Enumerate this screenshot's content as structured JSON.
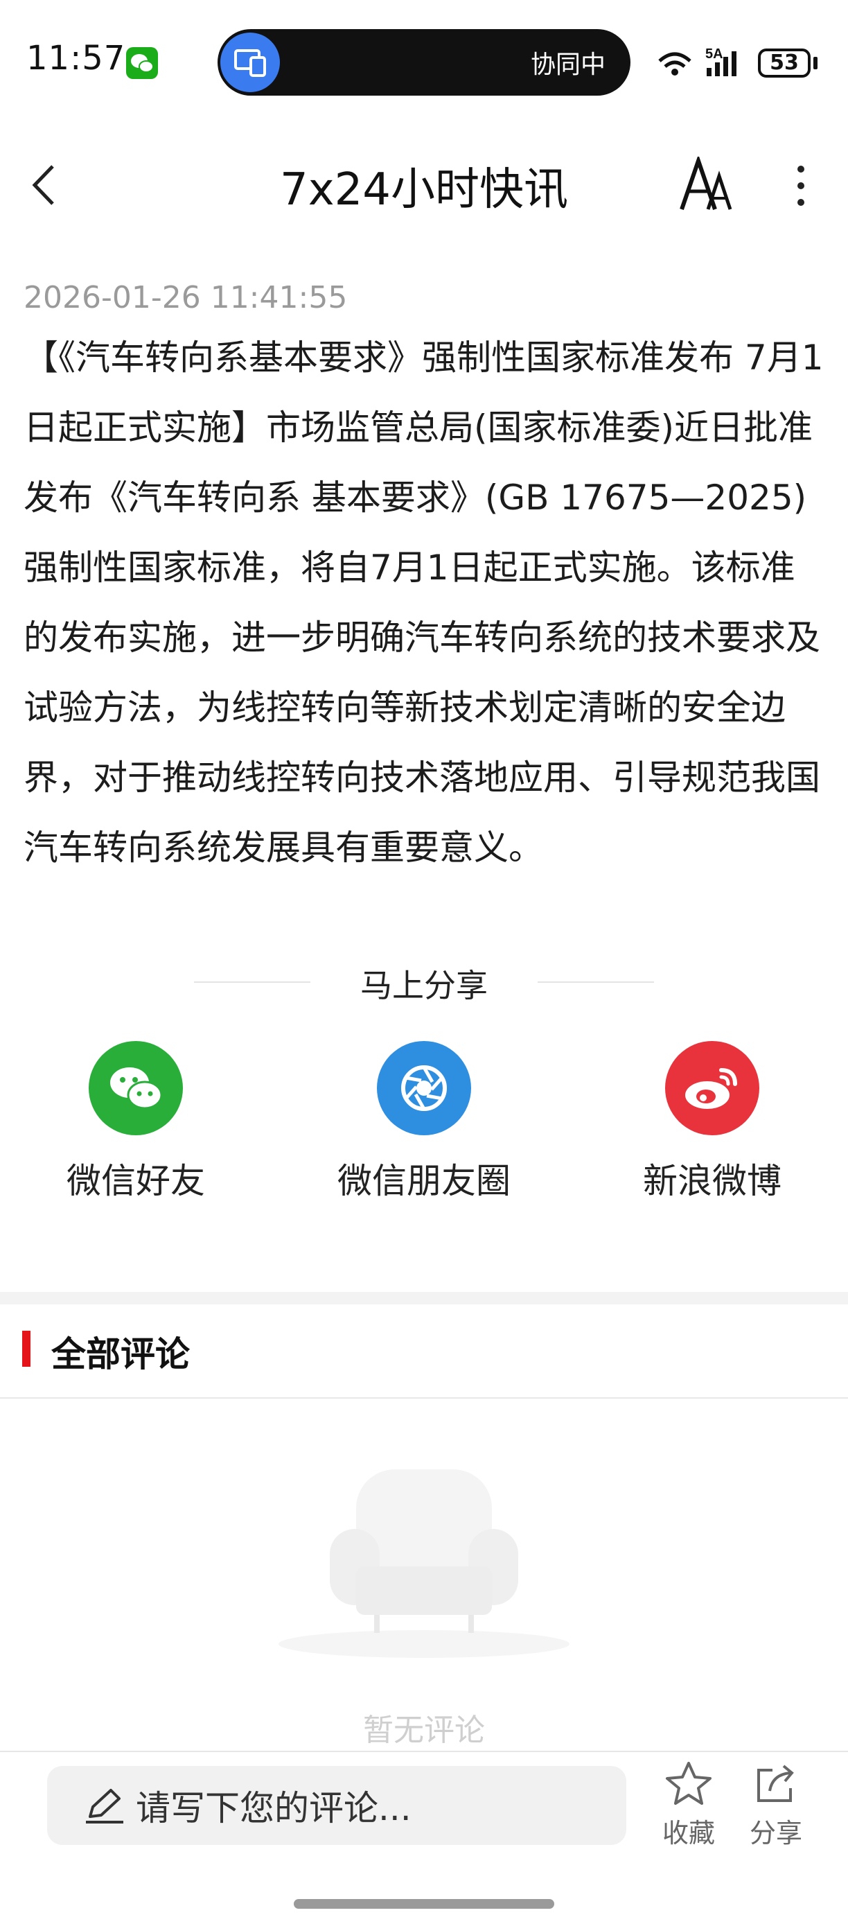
{
  "status_bar": {
    "time": "11:57",
    "island_text": "协同中",
    "network": "5A",
    "battery": "53"
  },
  "header": {
    "title": "7x24小时快讯",
    "back_icon": "chevron-left-icon",
    "font_icon": "font-size-icon",
    "more_icon": "more-vertical-icon"
  },
  "article": {
    "timestamp": "2026-01-26 11:41:55",
    "body": "【《汽车转向系基本要求》强制性国家标准发布 7月1日起正式实施】市场监管总局(国家标准委)近日批准发布《汽车转向系 基本要求》(GB 17675—2025)强制性国家标准，将自7月1日起正式实施。该标准的发布实施，进一步明确汽车转向系统的技术要求及试验方法，为线控转向等新技术划定清晰的安全边界，对于推动线控转向技术落地应用、引导规范我国汽车转向系统发展具有重要意义。"
  },
  "share": {
    "title": "马上分享",
    "items": [
      {
        "label": "微信好友",
        "icon": "wechat-icon",
        "color": "#2aae3a"
      },
      {
        "label": "微信朋友圈",
        "icon": "moments-icon",
        "color": "#2e8fe0"
      },
      {
        "label": "新浪微博",
        "icon": "weibo-icon",
        "color": "#e8333d"
      }
    ]
  },
  "comments": {
    "title": "全部评论",
    "empty_text": "暂无评论",
    "accent": "#e5141b"
  },
  "bottom_bar": {
    "placeholder": "请写下您的评论...",
    "favorite_label": "收藏",
    "share_label": "分享"
  }
}
